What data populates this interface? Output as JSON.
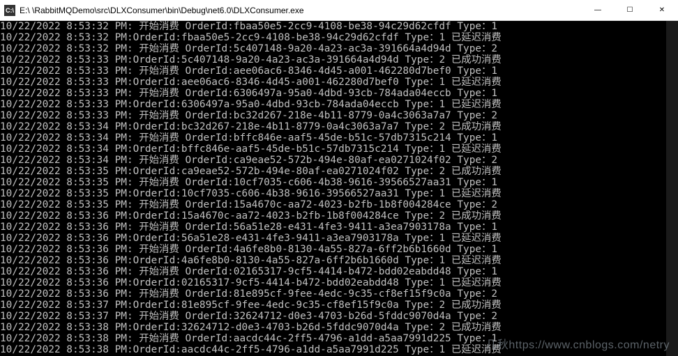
{
  "window": {
    "icon_label": "C:\\",
    "title": "E:\\    \\RabbitMQDemo\\src\\DLXConsumer\\bin\\Debug\\net6.0\\DLXConsumer.exe",
    "controls": {
      "minimize": "—",
      "maximize": "☐",
      "close": "✕"
    }
  },
  "watermark": "几秋https://www.cnblogs.com/netry",
  "log_lines": [
    "10/22/2022 8:53:32 PM: 开始消费 OrderId:fbaa50e5-2cc9-4108-be38-94c29d62cfdf Type：1",
    "10/22/2022 8:53:32 PM:OrderId:fbaa50e5-2cc9-4108-be38-94c29d62cfdf Type：1 已延迟消费",
    "10/22/2022 8:53:32 PM: 开始消费 OrderId:5c407148-9a20-4a23-ac3a-391664a4d94d Type：2",
    "10/22/2022 8:53:33 PM:OrderId:5c407148-9a20-4a23-ac3a-391664a4d94d Type：2 已成功消费",
    "10/22/2022 8:53:33 PM: 开始消费 OrderId:aee06ac6-8346-4d45-a001-462280d7bef0 Type：1",
    "10/22/2022 8:53:33 PM:OrderId:aee06ac6-8346-4d45-a001-462280d7bef0 Type：1 已延迟消费",
    "10/22/2022 8:53:33 PM: 开始消费 OrderId:6306497a-95a0-4dbd-93cb-784ada04eccb Type：1",
    "10/22/2022 8:53:33 PM:OrderId:6306497a-95a0-4dbd-93cb-784ada04eccb Type：1 已延迟消费",
    "10/22/2022 8:53:33 PM: 开始消费 OrderId:bc32d267-218e-4b11-8779-0a4c3063a7a7 Type：2",
    "10/22/2022 8:53:34 PM:OrderId:bc32d267-218e-4b11-8779-0a4c3063a7a7 Type：2 已成功消费",
    "10/22/2022 8:53:34 PM: 开始消费 OrderId:bffc846e-aaf5-45de-b51c-57db7315c214 Type：1",
    "10/22/2022 8:53:34 PM:OrderId:bffc846e-aaf5-45de-b51c-57db7315c214 Type：1 已延迟消费",
    "10/22/2022 8:53:34 PM: 开始消费 OrderId:ca9eae52-572b-494e-80af-ea0271024f02 Type：2",
    "10/22/2022 8:53:35 PM:OrderId:ca9eae52-572b-494e-80af-ea0271024f02 Type：2 已成功消费",
    "10/22/2022 8:53:35 PM: 开始消费 OrderId:10cf7035-c606-4b38-9616-39566527aa31 Type：1",
    "10/22/2022 8:53:35 PM:OrderId:10cf7035-c606-4b38-9616-39566527aa31 Type：1 已延迟消费",
    "10/22/2022 8:53:35 PM: 开始消费 OrderId:15a4670c-aa72-4023-b2fb-1b8f004284ce Type：2",
    "10/22/2022 8:53:36 PM:OrderId:15a4670c-aa72-4023-b2fb-1b8f004284ce Type：2 已成功消费",
    "10/22/2022 8:53:36 PM: 开始消费 OrderId:56a51e28-e431-4fe3-9411-a3ea7903178a Type：1",
    "10/22/2022 8:53:36 PM:OrderId:56a51e28-e431-4fe3-9411-a3ea7903178a Type：1 已延迟消费",
    "10/22/2022 8:53:36 PM: 开始消费 OrderId:4a6fe8b0-8130-4a55-827a-6ff2b6b1660d Type：1",
    "10/22/2022 8:53:36 PM:OrderId:4a6fe8b0-8130-4a55-827a-6ff2b6b1660d Type：1 已延迟消费",
    "10/22/2022 8:53:36 PM: 开始消费 OrderId:02165317-9cf5-4414-b472-bdd02eabdd48 Type：1",
    "10/22/2022 8:53:36 PM:OrderId:02165317-9cf5-4414-b472-bdd02eabdd48 Type：1 已延迟消费",
    "10/22/2022 8:53:36 PM: 开始消费 OrderId:81e895cf-9fee-4edc-9c35-cf8ef15f9c0a Type：2",
    "10/22/2022 8:53:37 PM:OrderId:81e895cf-9fee-4edc-9c35-cf8ef15f9c0a Type：2 已成功消费",
    "10/22/2022 8:53:37 PM: 开始消费 OrderId:32624712-d0e3-4703-b26d-5fddc9070d4a Type：2",
    "10/22/2022 8:53:38 PM:OrderId:32624712-d0e3-4703-b26d-5fddc9070d4a Type：2 已成功消费",
    "10/22/2022 8:53:38 PM: 开始消费 OrderId:aacdc44c-2ff5-4796-a1dd-a5aa7991d225 Type：1",
    "10/22/2022 8:53:38 PM:OrderId:aacdc44c-2ff5-4796-a1dd-a5aa7991d225 Type：1 已延迟消费"
  ]
}
